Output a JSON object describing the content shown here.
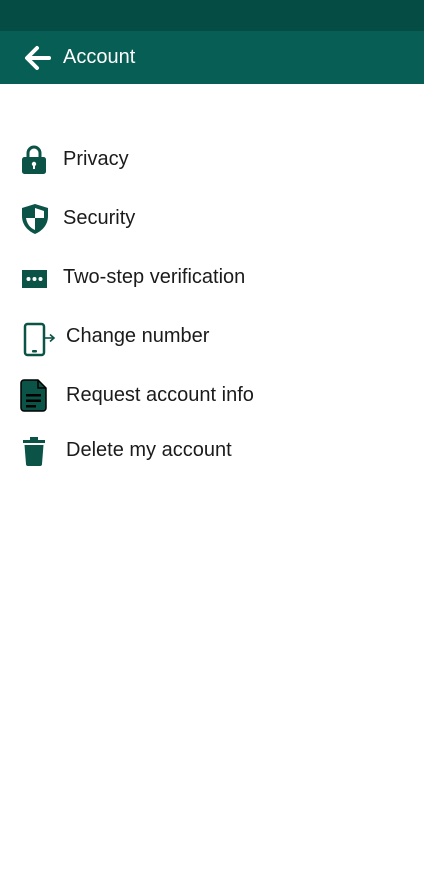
{
  "header": {
    "title": "Account",
    "back_icon": "arrow-left-icon"
  },
  "colors": {
    "status_bar": "#054d44",
    "app_bar": "#075e54",
    "icon": "#0b5346",
    "text": "#1b1b1b"
  },
  "menu": {
    "items": [
      {
        "label": "Privacy",
        "icon": "lock-icon"
      },
      {
        "label": "Security",
        "icon": "shield-icon"
      },
      {
        "label": "Two-step verification",
        "icon": "password-dots-icon"
      },
      {
        "label": "Change number",
        "icon": "phone-transfer-icon"
      },
      {
        "label": "Request account info",
        "icon": "document-icon"
      },
      {
        "label": "Delete my account",
        "icon": "trash-icon"
      }
    ]
  }
}
